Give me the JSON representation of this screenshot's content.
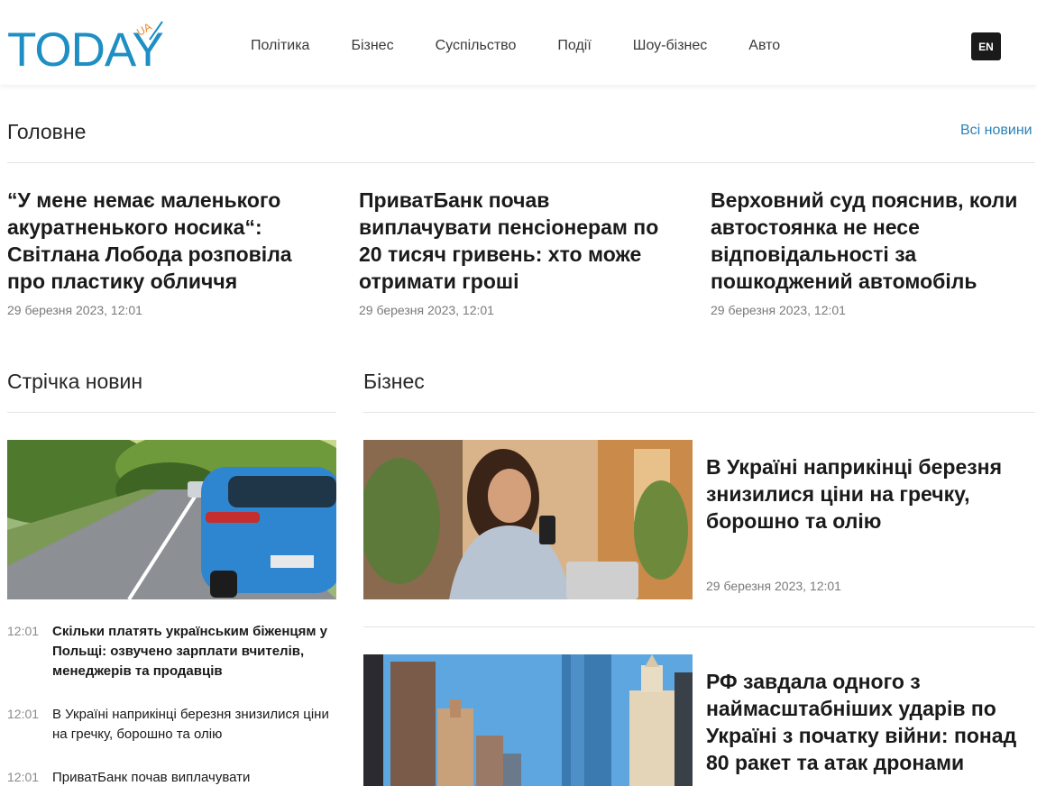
{
  "header": {
    "logo_text": "TODAY",
    "logo_badge": "UA",
    "nav": [
      "Політика",
      "Бізнес",
      "Суспільство",
      "Події",
      "Шоу-бізнес",
      "Авто"
    ],
    "lang": "EN"
  },
  "main": {
    "title": "Головне",
    "all_news": "Всі новини",
    "articles": [
      {
        "title": "“У мене немає маленького акуратненького носика“: Світлана Лобода розповіла про пластику обличчя",
        "date": "29 березня 2023, 12:01"
      },
      {
        "title": "ПриватБанк почав виплачувати пенсіонерам по 20 тисяч гривень: хто може отримати гроші",
        "date": "29 березня 2023, 12:01"
      },
      {
        "title": "Верховний суд пояснив, коли автостоянка не несе відповідальності за пошкоджений автомобіль",
        "date": "29 березня 2023, 12:01"
      }
    ]
  },
  "feed": {
    "title": "Стрічка новин",
    "items": [
      {
        "time": "12:01",
        "text": "Скільки платять українським біженцям у Польщі: озвучено зарплати вчителів, менеджерів та продавців"
      },
      {
        "time": "12:01",
        "text": "В Україні наприкінці березня знизилися ціни на гречку, борошно та олію"
      },
      {
        "time": "12:01",
        "text": "ПриватБанк почав виплачувати"
      }
    ]
  },
  "business": {
    "title": "Бізнес",
    "articles": [
      {
        "title": "В Україні наприкінці березня знизилися ціни на гречку, борошно та олію",
        "date": "29 березня 2023, 12:01"
      },
      {
        "title": "РФ завдала одного з наймасштабніших ударів по Україні з початку війни: понад 80 ракет та атак дронами"
      }
    ]
  },
  "colors": {
    "logo_blue": "#1e8fc4",
    "logo_orange": "#e8882a",
    "link": "#2b82b8"
  }
}
